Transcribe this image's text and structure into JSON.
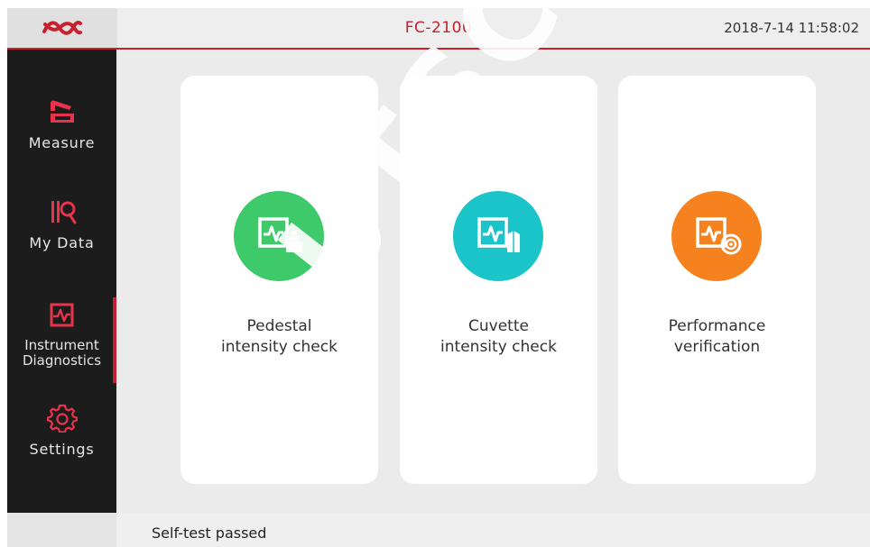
{
  "header": {
    "logo": "brand-logo",
    "title": "FC-2100",
    "datetime": "2018-7-14  11:58:02"
  },
  "sidebar": {
    "items": [
      {
        "label": "Measure",
        "icon": "measure-icon"
      },
      {
        "label": "My Data",
        "icon": "my-data-icon"
      },
      {
        "label_line1": "Instrument",
        "label_line2": "Diagnostics",
        "icon": "diagnostics-icon",
        "active": true
      },
      {
        "label": "Settings",
        "icon": "gear-icon"
      }
    ]
  },
  "cards": [
    {
      "line1": "Pedestal",
      "line2": "intensity check",
      "icon": "pedestal-check-icon",
      "color": "#3ec96b"
    },
    {
      "line1": "Cuvette",
      "line2": "intensity check",
      "icon": "cuvette-check-icon",
      "color": "#1bc4c9"
    },
    {
      "line1": "Performance",
      "line2": "verification",
      "icon": "performance-verification-icon",
      "color": "#f5821f"
    }
  ],
  "status": {
    "text": "Self-test passed"
  },
  "watermark": "UTSCHER S",
  "colors": {
    "accent": "#c8202e",
    "sidebar_bg": "#1c1c1c"
  }
}
